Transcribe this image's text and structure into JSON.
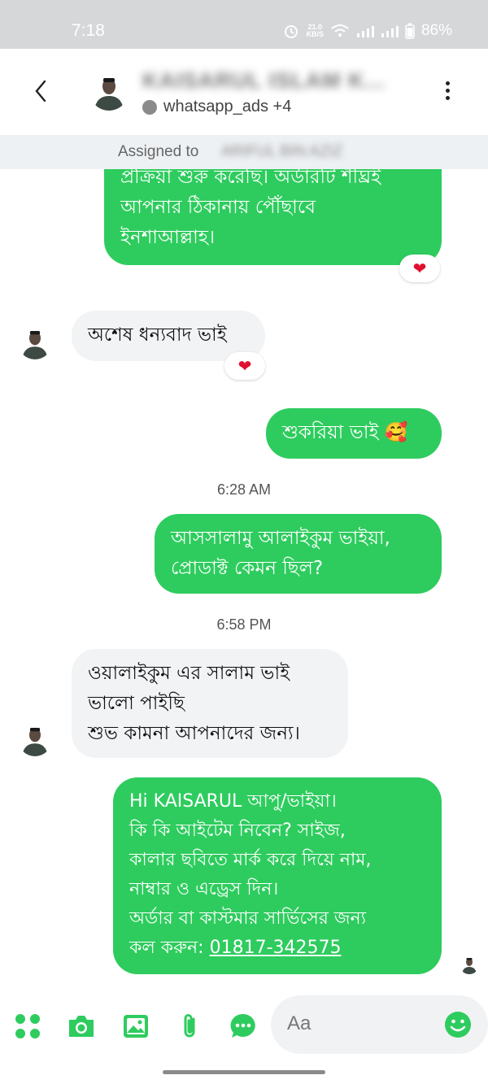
{
  "status_bar": {
    "time": "7:18",
    "net_speed_value": "21.0",
    "net_speed_unit": "KB/S",
    "battery": "86%"
  },
  "header": {
    "contact_name": "KAISARUL ISLAM K...",
    "channel": "whatsapp_ads +4",
    "back_icon": "chevron-left-icon",
    "more_icon": "more-vertical-icon"
  },
  "assigned": {
    "label": "Assigned to",
    "agent_name": "ARIFUL BIN AZIZ"
  },
  "messages": [
    {
      "direction": "outgoing",
      "text": "প্রক্রিয়া শুরু করেছি। অর্ডারটি শীঘ্রই\nআপনার ঠিকানায় পৌঁছাবে\nইনশাআল্লাহ।",
      "reaction": "❤"
    },
    {
      "direction": "incoming",
      "text": "অশেষ ধন্যবাদ ভাই",
      "reaction": "❤"
    },
    {
      "direction": "outgoing",
      "text": "শুকরিয়া ভাই 🥰"
    },
    {
      "timestamp": "6:28 AM"
    },
    {
      "direction": "outgoing",
      "text": "আসসালামু আলাইকুম ভাইয়া,\nপ্রোডাক্ট কেমন ছিল?"
    },
    {
      "timestamp": "6:58 PM"
    },
    {
      "direction": "incoming",
      "text": "ওয়ালাইকুম এর সালাম ভাই\nভালো পাইছি\nশুভ কামনা আপনাদের জন্য।"
    },
    {
      "direction": "outgoing",
      "text": "Hi KAISARUL  আপু/ভাইয়া।\nকি কি আইটেম নিবেন? সাইজ,\nকালার ছবিতে মার্ক করে দিয়ে নাম,\nনাম্বার ও এড্রেস দিন।\nঅর্ডার বা কাস্টমার সার্ভিসের জন্য\nকল করুন: ",
      "link": "01817-342575"
    }
  ],
  "composer": {
    "placeholder": "Aa",
    "icons": [
      "apps-icon",
      "camera-icon",
      "image-icon",
      "attachment-icon",
      "chat-icon",
      "emoji-icon"
    ]
  },
  "colors": {
    "outgoing_bubble": "#2ecc5e",
    "incoming_bubble": "#f2f3f5",
    "accent": "#2ecc5e",
    "status_bar": "#d6d7d9",
    "assigned_bar": "#eef1f4"
  }
}
